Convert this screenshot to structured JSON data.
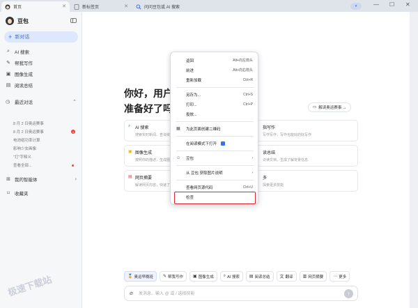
{
  "tabs": [
    {
      "label": "首页",
      "active": true
    },
    {
      "label": "新标签页",
      "active": false
    },
    {
      "label": "问问豆包或 AI 搜索",
      "active": false
    }
  ],
  "window_controls": {
    "minimize": "—",
    "maximize": "☐",
    "close": "✕"
  },
  "sidebar": {
    "brand": "豆包",
    "new_chat": "新对话",
    "nav": [
      {
        "label": "AI 搜索",
        "icon": "search-icon"
      },
      {
        "label": "帮我写作",
        "icon": "pen-icon"
      },
      {
        "label": "图像生成",
        "icon": "image-icon"
      },
      {
        "label": "阅读总结",
        "icon": "book-icon"
      }
    ],
    "recent_title": "最近对话",
    "recent": [
      {
        "label": "8 月 2 日奥运赛事",
        "badge": ""
      },
      {
        "label": "8 月 2 日奥运赛事",
        "badge": "4"
      },
      {
        "label": "电池组功率计算",
        "badge": ""
      },
      {
        "label": "影响少女画像",
        "badge": ""
      },
      {
        "label": "\"打\"字释义",
        "badge": ""
      },
      {
        "label": "查看全部...",
        "badge": "dot"
      }
    ],
    "agents": "我的智能体",
    "favorites": "收藏夹"
  },
  "main": {
    "greeting_line1": "你好，用户",
    "greeting_line2": "准备好了吗",
    "promo": "解读奥运赛事 →",
    "cards_left": [
      {
        "title": "AI 搜索",
        "desc": "搜索实时新闻、查询资料",
        "icon": "🔍",
        "color": "#3a6ff5"
      },
      {
        "title": "图像生成",
        "desc": "按照你的描述，生成图像",
        "icon": "🖼",
        "color": "#f0b400"
      },
      {
        "title": "网页摘要",
        "desc": "解读网页内容，快速了解",
        "icon": "📄",
        "color": "#e5484d"
      }
    ],
    "cards_right": [
      {
        "title": "指写作",
        "desc": "写作写作，写作也能好的好写作"
      },
      {
        "title": "读总结",
        "desc": "识读文档，生成了解背景信息"
      },
      {
        "title": "多",
        "desc": "探索更多技能"
      }
    ],
    "chips": [
      {
        "label": "奥运早晚班",
        "icon": "🏅"
      },
      {
        "label": "帮我写作",
        "icon": "✎"
      },
      {
        "label": "图像生成",
        "icon": "▣"
      },
      {
        "label": "AI 搜索",
        "icon": "⌕"
      },
      {
        "label": "阅读总结",
        "icon": "▤"
      },
      {
        "label": "翻译",
        "icon": "文"
      },
      {
        "label": "网页摘要",
        "icon": "▥"
      },
      {
        "label": "更多",
        "icon": "⋯"
      }
    ],
    "input_placeholder": "发消息、输入 @ 或 / 选择技能"
  },
  "context_menu": {
    "items": [
      {
        "label": "返回",
        "shortcut": "Alt+向左箭头",
        "icon": ""
      },
      {
        "label": "前进",
        "shortcut": "Alt+向右箭头",
        "icon": ""
      },
      {
        "label": "重新加载",
        "shortcut": "Ctrl+R",
        "icon": ""
      },
      {
        "label": "另存为...",
        "shortcut": "Ctrl+S",
        "icon": ""
      },
      {
        "label": "打印...",
        "shortcut": "Ctrl+P",
        "icon": ""
      },
      {
        "label": "投放...",
        "shortcut": "",
        "icon": ""
      },
      {
        "label": "为此页面创建二维码",
        "shortcut": "",
        "icon": "▦"
      },
      {
        "label": "在阅读模式下打开",
        "shortcut": "",
        "icon": ""
      },
      {
        "label": "豆包",
        "shortcut": "›",
        "icon": "☺"
      },
      {
        "label": "从 豆包 获取图片说明",
        "shortcut": "›",
        "icon": ""
      },
      {
        "label": "查看网页源代码",
        "shortcut": "Ctrl+U",
        "icon": ""
      },
      {
        "label": "检查",
        "shortcut": "",
        "icon": ""
      }
    ]
  },
  "watermark": "极速下载站",
  "colors": {
    "accent": "#3a6ff5",
    "highlight": "#d9282f",
    "sidebar_bg": "#f6f7f9"
  }
}
